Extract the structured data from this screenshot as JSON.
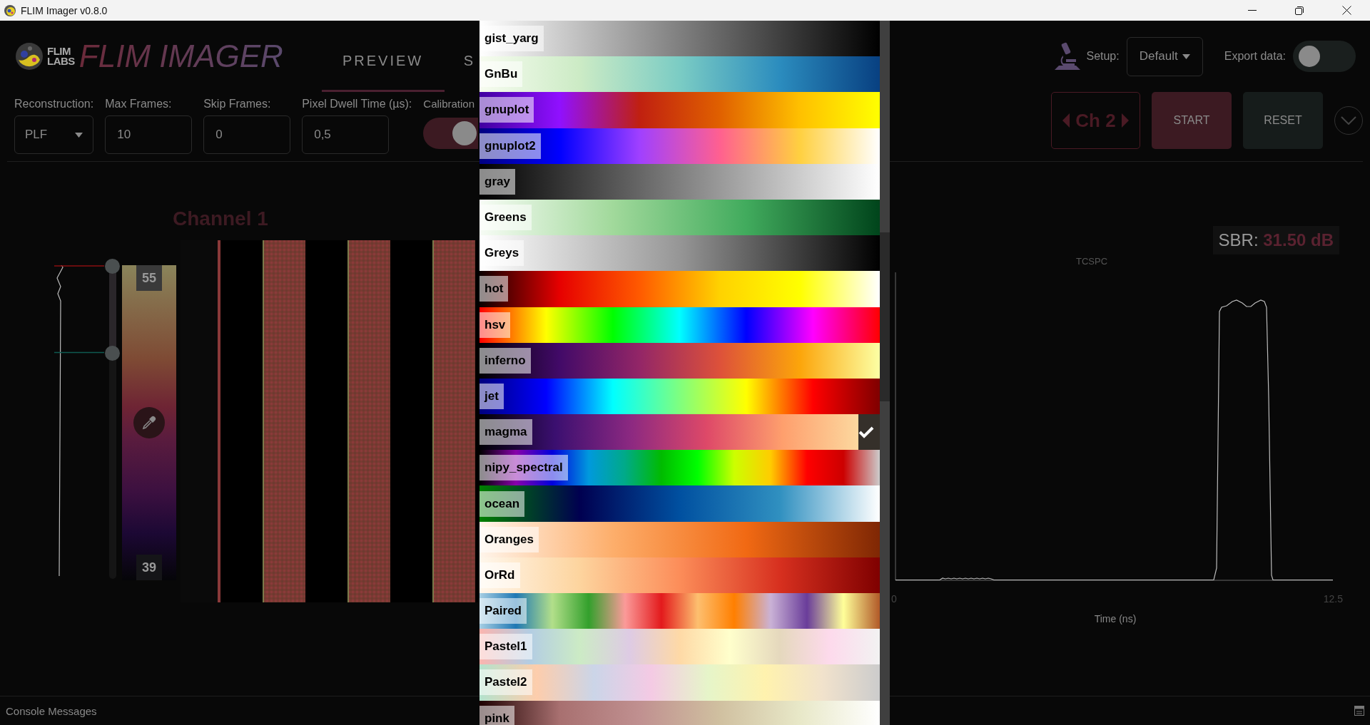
{
  "window": {
    "title": "FLIM Imager v0.8.0"
  },
  "brand": {
    "mark_top": "FLIM",
    "mark_bottom": "LABS",
    "title": "FLIM IMAGER"
  },
  "tabs": [
    {
      "label": "PREVIEW",
      "selected": true
    },
    {
      "label": "S",
      "selected": false
    }
  ],
  "setup": {
    "label": "Setup:",
    "value": "Default"
  },
  "export": {
    "label": "Export data:",
    "on": false
  },
  "controls": [
    {
      "kind": "select",
      "label": "Reconstruction:",
      "value": "PLF"
    },
    {
      "kind": "input",
      "label": "Max Frames:",
      "value": "10"
    },
    {
      "kind": "input",
      "label": "Skip Frames:",
      "value": "0"
    },
    {
      "kind": "input",
      "label": "Pixel Dwell Time (µs):",
      "value": "0,5"
    },
    {
      "kind": "toggle",
      "label": "Calibration",
      "on": true
    }
  ],
  "channel_selector": {
    "label": "Ch 2"
  },
  "buttons": [
    {
      "kind": "start",
      "label": "START"
    },
    {
      "kind": "reset",
      "label": "RESET"
    }
  ],
  "channel_view": {
    "title": "Channel 1",
    "max": "55",
    "min": "39",
    "thresholds": [
      {
        "level": 1
      },
      {
        "level": 0.71
      }
    ]
  },
  "chart": {
    "title": "TCSPC",
    "xlabel": "Time (ns)",
    "xticks": [
      "0",
      "12.5"
    ]
  },
  "sbr": {
    "label": "SBR:",
    "value": "31.50",
    "unit": "dB"
  },
  "colormaps": [
    {
      "name": "gist_yarg",
      "selected": false
    },
    {
      "name": "GnBu",
      "selected": false
    },
    {
      "name": "gnuplot",
      "selected": false
    },
    {
      "name": "gnuplot2",
      "selected": false
    },
    {
      "name": "gray",
      "selected": false
    },
    {
      "name": "Greens",
      "selected": false
    },
    {
      "name": "Greys",
      "selected": false
    },
    {
      "name": "hot",
      "selected": false
    },
    {
      "name": "hsv",
      "selected": false
    },
    {
      "name": "inferno",
      "selected": false
    },
    {
      "name": "jet",
      "selected": false
    },
    {
      "name": "magma",
      "selected": true
    },
    {
      "name": "nipy_spectral",
      "selected": false
    },
    {
      "name": "ocean",
      "selected": false
    },
    {
      "name": "Oranges",
      "selected": false
    },
    {
      "name": "OrRd",
      "selected": false
    },
    {
      "name": "Paired",
      "selected": false
    },
    {
      "name": "Pastel1",
      "selected": false
    },
    {
      "name": "Pastel2",
      "selected": false
    },
    {
      "name": "pink",
      "selected": false
    }
  ],
  "console": {
    "label": "Console Messages"
  }
}
